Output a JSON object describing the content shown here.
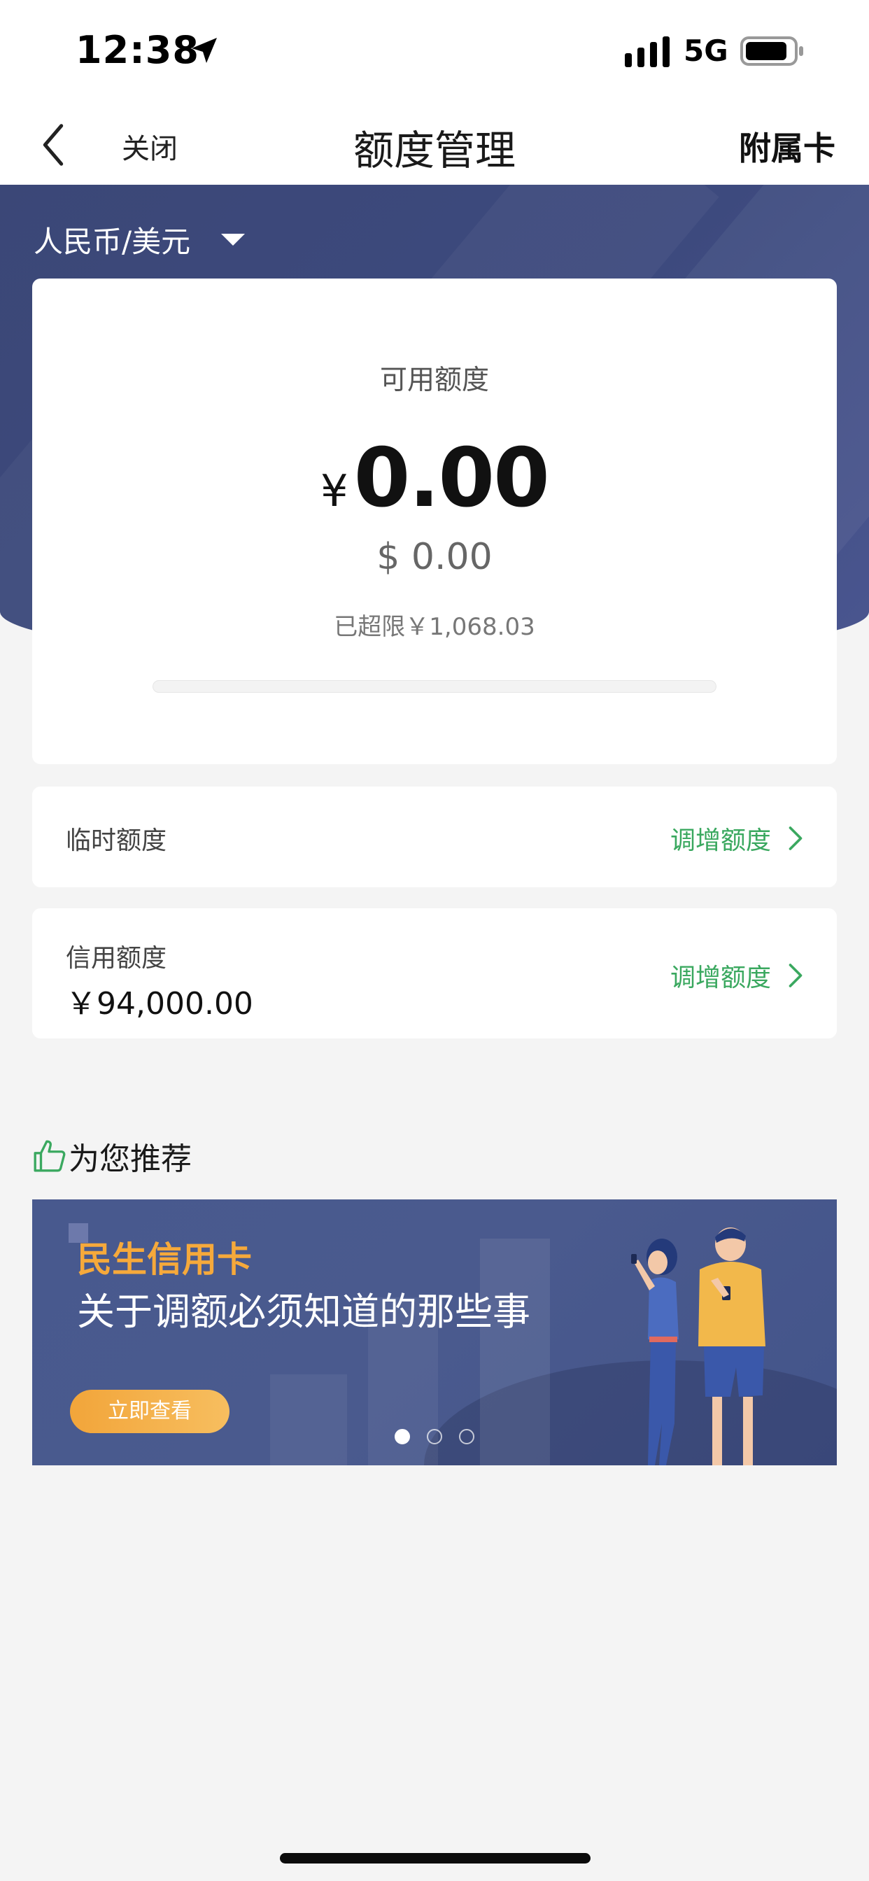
{
  "status_bar": {
    "time": "12:38",
    "network": "5G",
    "icons": [
      "location-arrow-icon",
      "signal-icon",
      "battery-icon"
    ]
  },
  "nav": {
    "back_icon": "chevron-left-icon",
    "close_label": "关闭",
    "title": "额度管理",
    "right_label": "附属卡"
  },
  "currency_selector": {
    "label": "人民币/美元",
    "icon": "caret-down-icon"
  },
  "available_card": {
    "label": "可用额度",
    "currency_symbol": "¥",
    "amount": "0.00",
    "usd_amount": "$ 0.00",
    "over_limit_text": "已超限￥1,068.03",
    "progress_fraction": 0
  },
  "temporary_limit": {
    "label": "临时额度",
    "action_label": "调增额度"
  },
  "credit_limit": {
    "label": "信用额度",
    "value": "￥94,000.00",
    "action_label": "调增额度"
  },
  "recommend": {
    "icon": "thumbs-up-icon",
    "title": "为您推荐",
    "banner": {
      "brand": "民生信用卡",
      "headline": "关于调额必须知道的那些事",
      "button_label": "立即查看",
      "slide_count": 3,
      "active_slide": 1
    }
  },
  "colors": {
    "header_bg": "#3d4a7e",
    "accent_green": "#3aa85f",
    "banner_orange": "#f6a93b",
    "page_bg": "#f4f4f4"
  }
}
